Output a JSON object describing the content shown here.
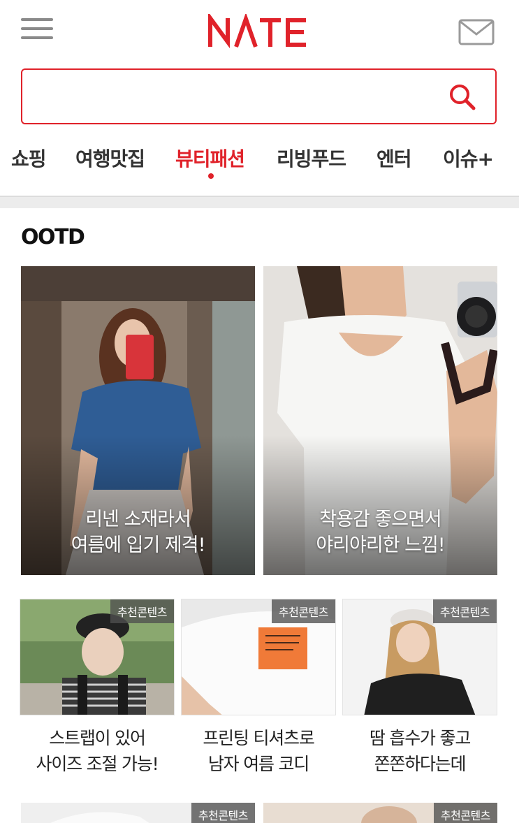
{
  "header": {
    "logo_text": "NATE",
    "menu_icon": "hamburger-menu-icon",
    "mail_icon": "envelope-icon",
    "brand_color": "#e0222a"
  },
  "search": {
    "value": "",
    "placeholder": "",
    "icon": "search-icon"
  },
  "tabs": [
    {
      "label": "쇼핑",
      "active": false
    },
    {
      "label": "여행맛집",
      "active": false
    },
    {
      "label": "뷰티패션",
      "active": true
    },
    {
      "label": "리빙푸드",
      "active": false
    },
    {
      "label": "엔터",
      "active": false
    },
    {
      "label": "이슈+",
      "active": false
    }
  ],
  "section": {
    "title": "OOTD"
  },
  "featured": [
    {
      "caption_line1": "리넨 소재라서",
      "caption_line2": "여름에 입기 제격!"
    },
    {
      "caption_line1": "착용감 좋으면서",
      "caption_line2": "야리야리한 느낌!"
    }
  ],
  "recommended": [
    {
      "badge": "추천콘텐츠",
      "caption_line1": "스트랩이 있어",
      "caption_line2": "사이즈 조절 가능!"
    },
    {
      "badge": "추천콘텐츠",
      "caption_line1": "프린팅 티셔츠로",
      "caption_line2": "남자 여름 코디"
    },
    {
      "badge": "추천콘텐츠",
      "caption_line1": "땀 흡수가 좋고",
      "caption_line2": "쫀쫀하다는데"
    }
  ],
  "bottom_cards": [
    {
      "badge": "추천콘텐츠"
    },
    {
      "badge": "추천콘텐츠"
    }
  ]
}
